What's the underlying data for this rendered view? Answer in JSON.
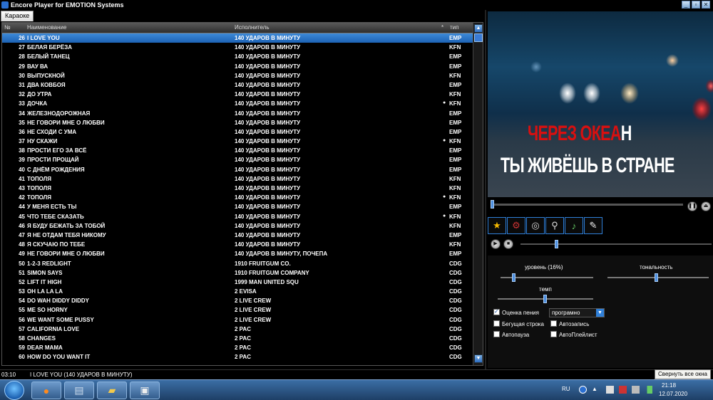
{
  "window": {
    "title": "Encore Player for EMOTION Systems"
  },
  "tabs": [
    {
      "label": "Караоке"
    }
  ],
  "list": {
    "headers": {
      "num": "№",
      "name": "Наименование",
      "artist": "Исполнитель",
      "star": "*",
      "type": "тип"
    },
    "rows": [
      {
        "num": "26",
        "name": "I LOVE YOU",
        "artist": "140 УДАРОВ В МИНУТУ",
        "star": "",
        "type": "EMP",
        "selected": true
      },
      {
        "num": "27",
        "name": "БЕЛАЯ БЕРЁЗА",
        "artist": "140 УДАРОВ В МИНУТУ",
        "star": "",
        "type": "KFN"
      },
      {
        "num": "28",
        "name": "БЕЛЫЙ ТАНЕЦ",
        "artist": "140 УДАРОВ В МИНУТУ",
        "star": "",
        "type": "EMP"
      },
      {
        "num": "29",
        "name": "ВАУ ВА",
        "artist": "140 УДАРОВ В МИНУТУ",
        "star": "",
        "type": "EMP"
      },
      {
        "num": "30",
        "name": "ВЫПУСКНОЙ",
        "artist": "140 УДАРОВ В МИНУТУ",
        "star": "",
        "type": "KFN"
      },
      {
        "num": "31",
        "name": "ДВА КОВБОЯ",
        "artist": "140 УДАРОВ В МИНУТУ",
        "star": "",
        "type": "EMP"
      },
      {
        "num": "32",
        "name": "ДО УТРА",
        "artist": "140 УДАРОВ В МИНУТУ",
        "star": "",
        "type": "KFN"
      },
      {
        "num": "33",
        "name": "ДОЧКА",
        "artist": "140 УДАРОВ В МИНУТУ",
        "star": "●",
        "type": "KFN"
      },
      {
        "num": "34",
        "name": "ЖЕЛЕЗНОДОРОЖНАЯ",
        "artist": "140 УДАРОВ В МИНУТУ",
        "star": "",
        "type": "EMP"
      },
      {
        "num": "35",
        "name": "НЕ ГОВОРИ МНЕ О ЛЮБВИ",
        "artist": "140 УДАРОВ В МИНУТУ",
        "star": "",
        "type": "EMP"
      },
      {
        "num": "36",
        "name": "НЕ СХОДИ С УМА",
        "artist": "140 УДАРОВ В МИНУТУ",
        "star": "",
        "type": "EMP"
      },
      {
        "num": "37",
        "name": "НУ СКАЖИ",
        "artist": "140 УДАРОВ В МИНУТУ",
        "star": "●",
        "type": "KFN"
      },
      {
        "num": "38",
        "name": "ПРОСТИ ЕГО ЗА ВСЁ",
        "artist": "140 УДАРОВ В МИНУТУ",
        "star": "",
        "type": "EMP"
      },
      {
        "num": "39",
        "name": "ПРОСТИ ПРОЩАЙ",
        "artist": "140 УДАРОВ В МИНУТУ",
        "star": "",
        "type": "EMP"
      },
      {
        "num": "40",
        "name": "С ДНЁМ РОЖДЕНИЯ",
        "artist": "140 УДАРОВ В МИНУТУ",
        "star": "",
        "type": "EMP"
      },
      {
        "num": "41",
        "name": "ТОПОЛЯ",
        "artist": "140 УДАРОВ В МИНУТУ",
        "star": "",
        "type": "KFN"
      },
      {
        "num": "43",
        "name": "ТОПОЛЯ",
        "artist": "140 УДАРОВ В МИНУТУ",
        "star": "",
        "type": "KFN"
      },
      {
        "num": "42",
        "name": "ТОПОЛЯ",
        "artist": "140 УДАРОВ В МИНУТУ",
        "star": "●",
        "type": "KFN"
      },
      {
        "num": "44",
        "name": "У МЕНЯ ЕСТЬ ТЫ",
        "artist": "140 УДАРОВ В МИНУТУ",
        "star": "",
        "type": "EMP"
      },
      {
        "num": "45",
        "name": "ЧТО ТЕБЕ СКАЗАТЬ",
        "artist": "140 УДАРОВ В МИНУТУ",
        "star": "●",
        "type": "KFN"
      },
      {
        "num": "46",
        "name": "Я БУДУ БЕЖАТЬ ЗА ТОБОЙ",
        "artist": "140 УДАРОВ В МИНУТУ",
        "star": "",
        "type": "KFN"
      },
      {
        "num": "47",
        "name": "Я НЕ ОТДАМ ТЕБЯ НИКОМУ",
        "artist": "140 УДАРОВ В МИНУТУ",
        "star": "",
        "type": "EMP"
      },
      {
        "num": "48",
        "name": "Я СКУЧАЮ ПО ТЕБЕ",
        "artist": "140 УДАРОВ В МИНУТУ",
        "star": "",
        "type": "KFN"
      },
      {
        "num": "49",
        "name": "НЕ ГОВОРИ МНЕ О ЛЮБВИ",
        "artist": "140 УДАРОВ В МИНУТУ, ПОЧЕПА",
        "star": "",
        "type": "EMP"
      },
      {
        "num": "50",
        "name": "1-2-3 REDLIGHT",
        "artist": "1910 FRUITGUM CO.",
        "star": "",
        "type": "CDG"
      },
      {
        "num": "51",
        "name": "SIMON SAYS",
        "artist": "1910 FRUITGUM COMPANY",
        "star": "",
        "type": "CDG"
      },
      {
        "num": "52",
        "name": "LIFT IT HIGH",
        "artist": "1999 MAN UNITED SQU",
        "star": "",
        "type": "CDG"
      },
      {
        "num": "53",
        "name": "OH LA LA LA",
        "artist": "2 EVISA",
        "star": "",
        "type": "CDG"
      },
      {
        "num": "54",
        "name": "DO WAH DIDDY DIDDY",
        "artist": "2 LIVE CREW",
        "star": "",
        "type": "CDG"
      },
      {
        "num": "55",
        "name": "ME SO HORNY",
        "artist": "2 LIVE CREW",
        "star": "",
        "type": "CDG"
      },
      {
        "num": "56",
        "name": "WE WANT SOME PUSSY",
        "artist": "2 LIVE CREW",
        "star": "",
        "type": "CDG"
      },
      {
        "num": "57",
        "name": "CALIFORNIA LOVE",
        "artist": "2 PAC",
        "star": "",
        "type": "CDG"
      },
      {
        "num": "58",
        "name": "CHANGES",
        "artist": "2 PAC",
        "star": "",
        "type": "CDG"
      },
      {
        "num": "59",
        "name": "DEAR MAMA",
        "artist": "2 PAC",
        "star": "",
        "type": "CDG"
      },
      {
        "num": "60",
        "name": "HOW DO YOU WANT IT",
        "artist": "2 PAC",
        "star": "",
        "type": "CDG"
      }
    ]
  },
  "status": {
    "time": "03:10",
    "now_playing": "I LOVE YOU (140 УДАРОВ В МИНУТУ)"
  },
  "tooltip": "Свернуть все окна",
  "video": {
    "lyric1_sung": "ЧЕРЕЗ ОКЕА",
    "lyric1_unsung": "Н",
    "lyric2": "ТЫ ЖИВЁШЬ В СТРАНЕ"
  },
  "toolbar": {
    "icons": [
      "star-icon",
      "gear-icon",
      "disc-search-icon",
      "magnifier-icon",
      "equalizer-icon",
      "notepad-icon"
    ]
  },
  "settings": {
    "level_label": "уровень (16%)",
    "tone_label": "тональность",
    "tempo_label": "темп",
    "score_label": "Оценка пения",
    "score_value": "програмно",
    "running_line": "Бегущая строка",
    "autorecord": "Автозапись",
    "autopause": "Автопауза",
    "autoplaylist": "АвтоПлейлист"
  },
  "tray": {
    "lang": "RU",
    "time": "21:18",
    "date": "12.07.2020"
  },
  "colors": {
    "accent": "#2f7fd8",
    "selection": "#1d62b4",
    "lyric_sung": "#d81010"
  }
}
